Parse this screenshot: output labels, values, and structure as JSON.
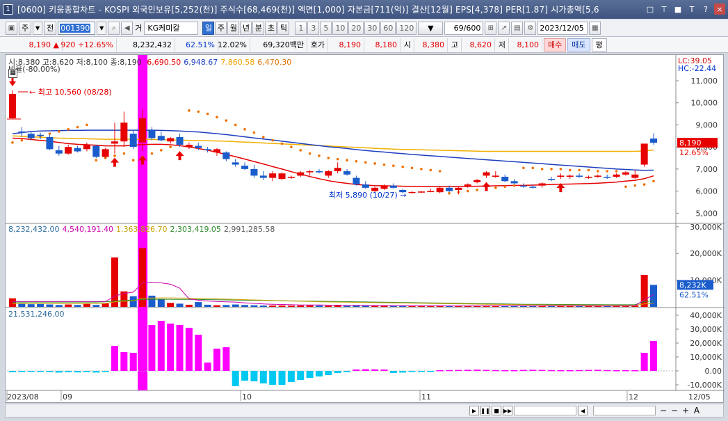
{
  "window": {
    "number": "1",
    "title": "[0600] 키움종합차트 - KOSPI 외국인보유[5,252(천)] 주식수[68,469(천)] 액면[1,000] 자본금[711(억)] 결산[12월] EPS[4,378] PER[1.87] 시가총액[5,6",
    "buttons": [
      "□",
      "⊤",
      "■",
      "T",
      "?",
      "×"
    ]
  },
  "toolbar": {
    "market_btn": "주",
    "prev_btn": "전",
    "stock_code": "001390",
    "sound_icon": "◀",
    "stock_prefix": "거",
    "stock_name": "KG케미칼",
    "period_tabs": [
      "일",
      "주",
      "월",
      "년",
      "분",
      "초",
      "틱"
    ],
    "selected_period": "일",
    "interval_tabs": [
      "1",
      "3",
      "5",
      "10",
      "20",
      "30",
      "60",
      "120"
    ],
    "bar_count": "69/600",
    "date": "2023/12/05"
  },
  "quote": {
    "price": "8,190",
    "change": "920",
    "change_pct": "+12.65%",
    "volume": "8,232,432",
    "volume_ratio": "62.51%",
    "turnover_ratio": "12.02%",
    "trade_value": "69,320백만",
    "hoga_label": "호가",
    "ask": "8,190",
    "bid": "8,180",
    "open_label": "시",
    "open": "8,380",
    "high_label": "고",
    "high": "8,620",
    "low_label": "저",
    "low": "8,100",
    "buy_btn": "매수",
    "sell_btn": "매도",
    "eval_btn": "평"
  },
  "price_panel": {
    "legend_ohlc": "시:8,380 고:8,620 저:8,100 종:8,190",
    "legend_ma": [
      {
        "text": "6,690.50",
        "color": "#e60000"
      },
      {
        "text": "6,948.67",
        "color": "#1d3fbf"
      },
      {
        "text": "7,860.58",
        "color": "#f0a000"
      },
      {
        "text": "6,470.30",
        "color": "#e07000"
      }
    ],
    "ratio_label": "비율(-80.00%)",
    "lc_label": "LC:39.05",
    "hc_label": "HC:-22.44",
    "high_annotation": "최고 10,560 (08/28)",
    "low_annotation": "최저 5,890 (10/27)",
    "current_price_tag": "8,190",
    "current_pct_tag": "12.65%",
    "y_ticks": [
      "11,000",
      "10,000",
      "9,000",
      "8,000",
      "7,000",
      "6,000",
      "5,000"
    ]
  },
  "volume_panel": {
    "legend": [
      {
        "text": "8,232,432.00",
        "color": "#2a6a9a"
      },
      {
        "text": "4,540,191.40",
        "color": "#cc00aa"
      },
      {
        "text": "1,363,826.70",
        "color": "#c8a000"
      },
      {
        "text": "2,303,419.05",
        "color": "#2a8a2a"
      },
      {
        "text": "2,991,285.58",
        "color": "#555555"
      }
    ],
    "y_ticks": [
      "30,000K",
      "20,000K",
      "10,000K"
    ],
    "current_tag": "8,232K",
    "current_pct_tag": "62.51%"
  },
  "osc_panel": {
    "legend": "21,531,246.00",
    "y_ticks": [
      "40,000K",
      "30,000K",
      "20,000K",
      "10,000K",
      "0.00",
      "-10,000K"
    ]
  },
  "x_axis": {
    "labels": [
      "2023/08",
      "09",
      "10",
      "11",
      "12",
      "12/05"
    ]
  },
  "chart_data": {
    "type": "candlestick",
    "y_unit": "KRW",
    "ylim": [
      4600,
      11600
    ],
    "x_start": "2023-08-28",
    "candles": [
      [
        9300,
        10560,
        9250,
        10400
      ],
      [
        8700,
        8900,
        8450,
        8650
      ],
      [
        8600,
        8700,
        8300,
        8400
      ],
      [
        8550,
        8650,
        8350,
        8500
      ],
      [
        8450,
        8550,
        7850,
        7900
      ],
      [
        7850,
        8050,
        7600,
        7700
      ],
      [
        7700,
        8100,
        7650,
        8000
      ],
      [
        7950,
        8050,
        7750,
        7800
      ],
      [
        7900,
        8200,
        7800,
        8100
      ],
      [
        8050,
        8100,
        7500,
        7550
      ],
      [
        7550,
        7950,
        7500,
        7900
      ],
      [
        8150,
        9100,
        7700,
        8250
      ],
      [
        8250,
        9600,
        8000,
        9100
      ],
      [
        8600,
        8750,
        7900,
        8000
      ],
      [
        8200,
        9700,
        7800,
        9300
      ],
      [
        8750,
        8900,
        8300,
        8400
      ],
      [
        8500,
        8700,
        8250,
        8300
      ],
      [
        8250,
        8450,
        8150,
        8400
      ],
      [
        8450,
        8600,
        8000,
        8100
      ],
      [
        8000,
        8200,
        7900,
        8100
      ],
      [
        8050,
        8200,
        7850,
        7950
      ],
      [
        7900,
        8000,
        7750,
        7850
      ],
      [
        7750,
        7950,
        7600,
        7900
      ],
      [
        7750,
        7800,
        7350,
        7450
      ],
      [
        7300,
        7450,
        7100,
        7200
      ],
      [
        7150,
        7300,
        6950,
        7000
      ],
      [
        7000,
        7200,
        6600,
        6700
      ],
      [
        6700,
        6900,
        6500,
        6600
      ],
      [
        6600,
        6900,
        6450,
        6800
      ],
      [
        6550,
        6850,
        6500,
        6800
      ],
      [
        6600,
        6700,
        6550,
        6650
      ],
      [
        6700,
        6900,
        6650,
        6850
      ],
      [
        6850,
        6950,
        6700,
        6900
      ],
      [
        6900,
        7000,
        6800,
        6850
      ],
      [
        6700,
        6950,
        6600,
        6900
      ],
      [
        6900,
        7300,
        6800,
        7050
      ],
      [
        6900,
        7000,
        6700,
        6750
      ],
      [
        6600,
        6700,
        6250,
        6300
      ],
      [
        6300,
        6450,
        6100,
        6150
      ],
      [
        6000,
        6200,
        5950,
        6150
      ],
      [
        6100,
        6300,
        6050,
        6250
      ],
      [
        6250,
        6350,
        6100,
        6150
      ],
      [
        6050,
        6100,
        5900,
        5950
      ],
      [
        5950,
        6000,
        5890,
        5960
      ],
      [
        5960,
        6000,
        5920,
        5980
      ],
      [
        6000,
        6100,
        5950,
        6000
      ],
      [
        5950,
        6200,
        5900,
        6150
      ],
      [
        6150,
        6250,
        5950,
        6000
      ],
      [
        6050,
        6200,
        5850,
        6150
      ],
      [
        6200,
        6350,
        6150,
        6300
      ],
      [
        6400,
        6550,
        6350,
        6500
      ],
      [
        6700,
        6900,
        6600,
        6850
      ],
      [
        6650,
        6900,
        6600,
        6700
      ],
      [
        6650,
        6750,
        6400,
        6450
      ],
      [
        6450,
        6550,
        6300,
        6350
      ],
      [
        6250,
        6350,
        6150,
        6200
      ],
      [
        6200,
        6300,
        6100,
        6150
      ],
      [
        6250,
        6400,
        6150,
        6350
      ],
      [
        6550,
        6650,
        6450,
        6500
      ],
      [
        6650,
        6800,
        6550,
        6700
      ],
      [
        6650,
        6750,
        6550,
        6700
      ],
      [
        6700,
        6800,
        6600,
        6650
      ],
      [
        6600,
        6700,
        6550,
        6650
      ],
      [
        6650,
        6750,
        6600,
        6700
      ],
      [
        6650,
        6750,
        6550,
        6600
      ],
      [
        6650,
        6800,
        6600,
        6750
      ],
      [
        6750,
        6900,
        6700,
        6850
      ],
      [
        6600,
        6950,
        6550,
        6750
      ],
      [
        7200,
        8150,
        7100,
        8150
      ],
      [
        8380,
        8620,
        8100,
        8190
      ]
    ],
    "ma_red": [
      8400,
      8380,
      8340,
      8300,
      8260,
      8200,
      8150,
      8120,
      8100,
      8080,
      8050,
      8050,
      8050,
      8080,
      8110,
      8120,
      8120,
      8100,
      8060,
      8000,
      7930,
      7850,
      7760,
      7660,
      7560,
      7450,
      7340,
      7230,
      7110,
      7000,
      6880,
      6770,
      6660,
      6560,
      6470,
      6400,
      6350,
      6300,
      6270,
      6250,
      6240,
      6230,
      6220,
      6210,
      6200,
      6200,
      6200,
      6200,
      6200,
      6210,
      6220,
      6230,
      6240,
      6250,
      6260,
      6260,
      6270,
      6280,
      6300,
      6310,
      6320,
      6330,
      6340,
      6360,
      6380,
      6410,
      6450,
      6490,
      6560,
      6690
    ],
    "ma_blue": [
      8600,
      8650,
      8700,
      8720,
      8730,
      8740,
      8750,
      8750,
      8760,
      8760,
      8760,
      8760,
      8760,
      8760,
      8760,
      8760,
      8750,
      8740,
      8720,
      8700,
      8680,
      8640,
      8600,
      8560,
      8510,
      8460,
      8410,
      8360,
      8310,
      8260,
      8210,
      8160,
      8110,
      8060,
      8010,
      7970,
      7930,
      7880,
      7840,
      7800,
      7770,
      7730,
      7700,
      7660,
      7630,
      7600,
      7570,
      7540,
      7510,
      7480,
      7450,
      7420,
      7390,
      7360,
      7330,
      7300,
      7270,
      7240,
      7210,
      7180,
      7150,
      7120,
      7090,
      7060,
      7030,
      7000,
      6980,
      6960,
      6940,
      6950
    ],
    "ma_yellow": [
      8500,
      8480,
      8460,
      8440,
      8420,
      8400,
      8390,
      8380,
      8370,
      8360,
      8350,
      8350,
      8350,
      8350,
      8350,
      8340,
      8330,
      8320,
      8310,
      8300,
      8290,
      8280,
      8270,
      8260,
      8240,
      8220,
      8200,
      8180,
      8160,
      8140,
      8120,
      8100,
      8080,
      8060,
      8040,
      8020,
      8000,
      7980,
      7960,
      7940,
      7920,
      7900,
      7890,
      7880,
      7870,
      7860,
      7850,
      7840,
      7830,
      7820,
      7810,
      7800,
      7800,
      7800,
      7800,
      7800,
      7800,
      7800,
      7800,
      7800,
      7800,
      7800,
      7800,
      7800,
      7800,
      7800,
      7800,
      7800,
      7820,
      7860
    ],
    "psar": [
      8200,
      8300,
      8400,
      8500,
      8600,
      8700,
      8800,
      8900,
      9000,
      7400,
      7500,
      7600,
      7700,
      7400,
      7550,
      7700,
      7850,
      8000,
      8150,
      9650,
      9600,
      9500,
      9350,
      9200,
      9000,
      8800,
      8650,
      8450,
      8300,
      8150,
      8000,
      7850,
      7700,
      7600,
      7500,
      7450,
      7400,
      7350,
      7300,
      7250,
      7200,
      7150,
      7100,
      7050,
      7000,
      6950,
      6900,
      5900,
      5950,
      6000,
      6050,
      6100,
      6150,
      6200,
      6250,
      7050,
      7050,
      7000,
      7000,
      7000,
      6950,
      6950,
      6950,
      6900,
      6900,
      6900,
      6200,
      6250,
      6300,
      6450
    ],
    "volume_k": [
      3200,
      1400,
      1000,
      1100,
      900,
      700,
      900,
      700,
      1200,
      700,
      1300,
      18500,
      5800,
      4000,
      22000,
      4200,
      3000,
      1500,
      1200,
      800,
      1800,
      800,
      600,
      700,
      900,
      700,
      600,
      500,
      500,
      500,
      450,
      500,
      550,
      500,
      450,
      700,
      400,
      500,
      450,
      400,
      400,
      350,
      350,
      300,
      300,
      350,
      350,
      300,
      400,
      350,
      350,
      500,
      500,
      350,
      350,
      300,
      300,
      350,
      400,
      400,
      350,
      350,
      350,
      300,
      300,
      400,
      400,
      500,
      12000,
      8232
    ],
    "vol_ma_pink": [
      2000,
      2000,
      2000,
      2000,
      2000,
      2000,
      2000,
      2000,
      2000,
      2000,
      2000,
      4000,
      5000,
      5500,
      9000,
      9200,
      9000,
      8500,
      7000,
      3000,
      2500,
      2200,
      2000,
      1900,
      1800,
      1500,
      1300,
      1100,
      1000,
      900,
      800,
      700,
      700,
      700,
      650,
      650,
      600,
      600,
      550,
      500,
      500,
      450,
      450,
      400,
      400,
      400,
      380,
      370,
      360,
      360,
      360,
      380,
      400,
      400,
      390,
      380,
      370,
      360,
      360,
      360,
      360,
      360,
      360,
      350,
      350,
      350,
      360,
      380,
      2700,
      4540
    ],
    "vol_ma_yellow": [
      1200,
      1200,
      1200,
      1200,
      1200,
      1200,
      1200,
      1200,
      1250,
      1250,
      1300,
      1900,
      2100,
      2300,
      3200,
      3300,
      3350,
      3350,
      3300,
      3250,
      3200,
      3100,
      3000,
      2900,
      2800,
      2700,
      2600,
      2500,
      2400,
      2300,
      2200,
      2100,
      2000,
      1900,
      1850,
      1800,
      1750,
      1700,
      1650,
      1600,
      1550,
      1500,
      1450,
      1400,
      1350,
      1300,
      1250,
      1200,
      1150,
      1100,
      1050,
      1000,
      950,
      900,
      850,
      800,
      780,
      760,
      740,
      720,
      700,
      680,
      660,
      640,
      620,
      600,
      600,
      600,
      1100,
      1363
    ],
    "vol_ma_green": [
      1800,
      1800,
      1800,
      1800,
      1800,
      1800,
      1800,
      1800,
      1800,
      1800,
      1900,
      2200,
      2400,
      2500,
      2800,
      2850,
      2850,
      2850,
      2800,
      2800,
      2750,
      2700,
      2650,
      2600,
      2550,
      2500,
      2450,
      2400,
      2350,
      2300,
      2250,
      2200,
      2150,
      2100,
      2050,
      2000,
      1950,
      1900,
      1850,
      1800,
      1750,
      1700,
      1650,
      1600,
      1550,
      1500,
      1450,
      1400,
      1350,
      1300,
      1250,
      1200,
      1150,
      1100,
      1050,
      1000,
      980,
      960,
      940,
      920,
      900,
      880,
      860,
      840,
      820,
      800,
      800,
      800,
      2000,
      2303
    ],
    "osc_k": [
      -1000,
      -800,
      -300,
      -500,
      -900,
      -1200,
      -1000,
      -1100,
      -900,
      -1200,
      -800,
      18000,
      13500,
      13000,
      30000,
      33000,
      36000,
      34000,
      33000,
      31000,
      26000,
      6000,
      16000,
      17000,
      -11000,
      -7000,
      -7500,
      -9000,
      -10000,
      -10000,
      -8000,
      -6500,
      -5000,
      -4000,
      -3000,
      -1500,
      -1000,
      1000,
      1200,
      1100,
      1000,
      -1500,
      -1200,
      -500,
      -300,
      -200,
      500,
      600,
      700,
      800,
      900,
      700,
      600,
      500,
      500,
      700,
      800,
      700,
      600,
      500,
      500,
      600,
      700,
      800,
      600,
      500,
      500,
      500,
      13000,
      21531
    ],
    "markers_up": [
      11,
      14,
      18,
      51,
      59
    ],
    "marker_down": 0,
    "highlight_index": 14,
    "lowest_index": 43
  }
}
